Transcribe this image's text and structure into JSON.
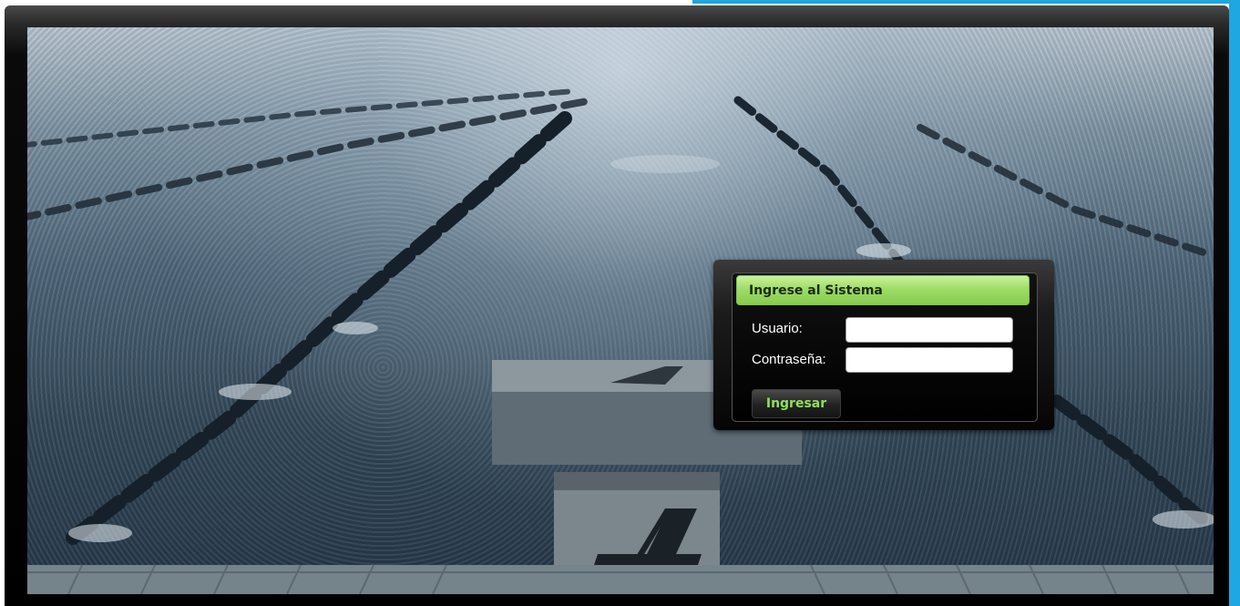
{
  "login": {
    "title": "Ingrese al Sistema",
    "username_label": "Usuario:",
    "username_value": "",
    "password_label": "Contraseña:",
    "password_value": "",
    "submit_label": "Ingresar"
  },
  "background": {
    "block_number": "4"
  },
  "colors": {
    "accent": "#1ea7e1",
    "header_green": "#9fdc68",
    "button_text": "#8fe05a"
  }
}
